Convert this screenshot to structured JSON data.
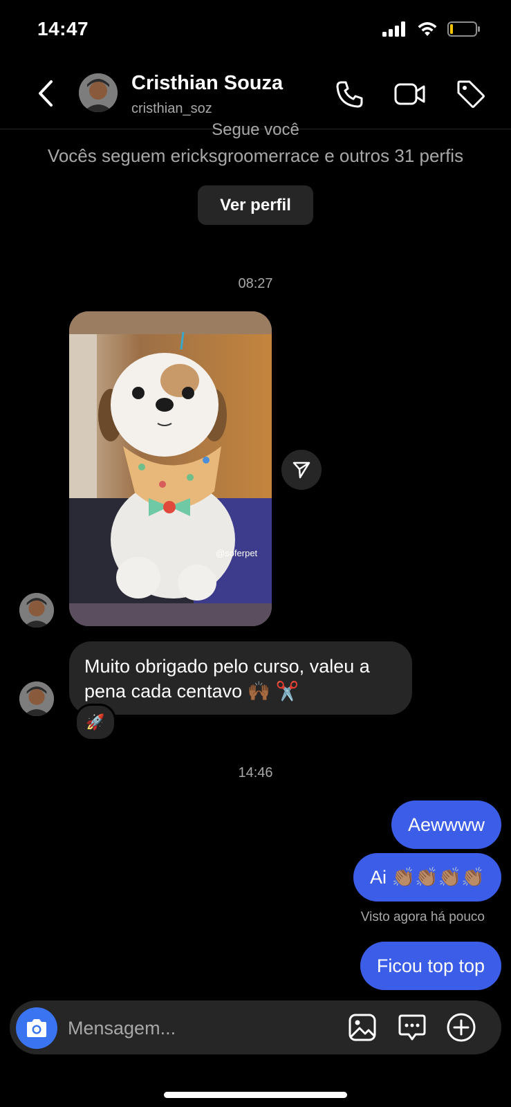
{
  "status_bar": {
    "time": "14:47"
  },
  "header": {
    "name": "Cristhian Souza",
    "username": "cristhian_soz"
  },
  "profile_summary": {
    "follows_you": "Segue você",
    "mutuals": "Vocês seguem ericksgroomerrace e outros 31 perfis",
    "view_profile_label": "Ver perfil"
  },
  "messages": {
    "timestamp_1": "08:27",
    "media_watermark": "@soferpet",
    "incoming_text": "Muito obrigado pelo curso, valeu a pena cada centavo 🙌🏾 ✂️",
    "reaction_emoji": "🚀",
    "timestamp_2": "14:46",
    "outgoing": [
      {
        "text": "Aewwww"
      },
      {
        "text": "Ai 👏🏽👏🏽👏🏽👏🏽"
      },
      {
        "text": "Ficou top top"
      }
    ],
    "seen_status": "Visto agora há pouco"
  },
  "composer": {
    "placeholder": "Mensagem..."
  },
  "colors": {
    "outgoing_bubble": "#3b5de7",
    "incoming_bubble": "#262626",
    "camera_button": "#3b74f0",
    "background": "#000000"
  },
  "icons": [
    "back-icon",
    "phone-icon",
    "video-camera-icon",
    "tag-icon",
    "send-icon",
    "camera-icon",
    "gallery-icon",
    "sticker-icon",
    "plus-icon"
  ]
}
